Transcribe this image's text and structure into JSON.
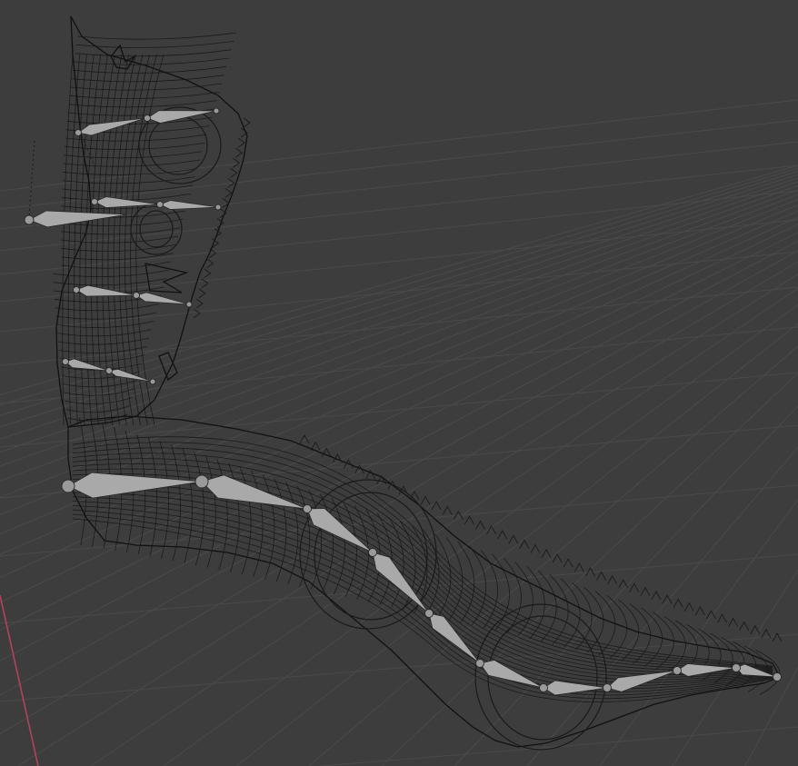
{
  "app": {
    "name": "3D viewport",
    "shading": "wireframe",
    "object": "tentacle-mesh-with-armature"
  },
  "colors": {
    "background": "#3d3d3d",
    "grid": "#4a4a4a",
    "x_axis": "#b0445a",
    "wire": "#151515",
    "bone": "#a9a9a9"
  },
  "armature": {
    "upper_chain_bones": 9,
    "lower_chain_bones": 10
  }
}
